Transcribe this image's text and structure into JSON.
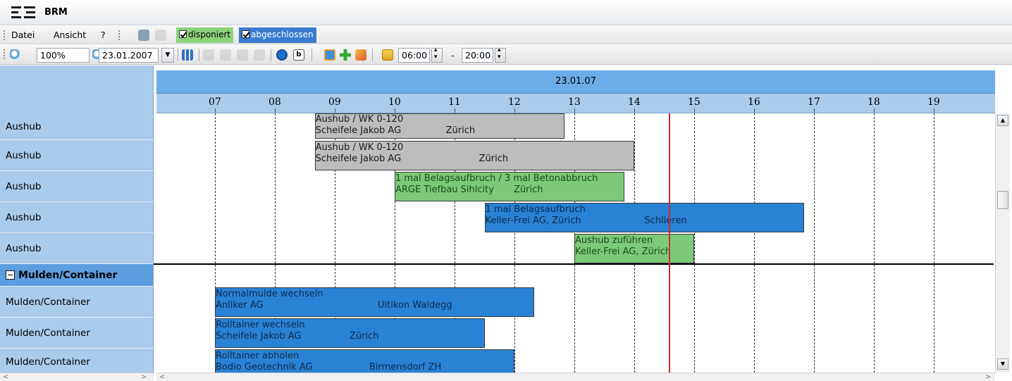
{
  "app": {
    "title": "BRM"
  },
  "menu": {
    "items": [
      "Datei",
      "Ansicht",
      "?"
    ],
    "checkboxes": [
      {
        "label": "disponiert",
        "checked": true,
        "color": "#8cd27a"
      },
      {
        "label": "abgeschlossen",
        "checked": true,
        "color": "#3a7bd0"
      }
    ]
  },
  "toolbar": {
    "zoom": "100%",
    "date": "23.01.2007",
    "time_from": "06:00",
    "separator": "-",
    "time_to": "20:00",
    "icons": [
      "zoom-in-icon",
      "zoom-out-icon",
      "filter-icon",
      "page-icon",
      "globe-icon",
      "bold-icon",
      "blue-square-icon",
      "add-icon",
      "arrow-icon",
      "sort-icon"
    ]
  },
  "gantt": {
    "date_header": "23.01.07",
    "hours": [
      "07",
      "08",
      "09",
      "10",
      "11",
      "12",
      "13",
      "14",
      "15",
      "16",
      "17",
      "18",
      "19"
    ],
    "current_time": "14:35",
    "colors": {
      "gray": "#bdbdbd",
      "green": "#7dc97a",
      "blue": "#2a82d4",
      "now_line": "#d42a2a"
    },
    "rows": [
      {
        "label": "Aushub",
        "group": false
      },
      {
        "label": "Aushub",
        "group": false
      },
      {
        "label": "Aushub",
        "group": false
      },
      {
        "label": "Aushub",
        "group": false
      },
      {
        "label": "Aushub",
        "group": false
      },
      {
        "label": "Mulden/Container",
        "group": true
      },
      {
        "label": "Mulden/Container",
        "group": false
      },
      {
        "label": "Mulden/Container",
        "group": false
      },
      {
        "label": "Mulden/Container",
        "group": false
      }
    ],
    "tasks": [
      {
        "row": 0,
        "start": "08:40",
        "end": "12:50",
        "status": "gray",
        "line1": "Aushub / WK 0-120",
        "line2a": "Scheifele Jakob AG",
        "line2b": "Zürich"
      },
      {
        "row": 1,
        "start": "08:40",
        "end": "14:00",
        "status": "gray",
        "line1": "Aushub / WK 0-120",
        "line2a": "Scheifele Jakob AG",
        "line2b": "Zürich"
      },
      {
        "row": 2,
        "start": "10:00",
        "end": "13:50",
        "status": "green",
        "line1": "1 mal Belagsaufbruch / 3 mal Betonabbruch",
        "line2a": "ARGE Tiefbau Sihlcity",
        "line2b": "Zürich"
      },
      {
        "row": 3,
        "start": "11:30",
        "end": "16:50",
        "status": "blue",
        "line1": "1 mal Belagsaufbruch",
        "line2a": "Keller-Frei AG, Zürich",
        "line2b": "Schlieren"
      },
      {
        "row": 4,
        "start": "13:00",
        "end": "15:00",
        "status": "green",
        "line1": "Aushub zuführen",
        "line2a": "Keller-Frei AG, Zürich",
        "line2b": ""
      },
      {
        "row": 6,
        "start": "07:00",
        "end": "12:20",
        "status": "blue",
        "line1": "Normalmulde wechseln",
        "line2a": "Anliker AG",
        "line2b": "Uitikon Waldegg"
      },
      {
        "row": 7,
        "start": "07:00",
        "end": "11:30",
        "status": "blue",
        "line1": "Rolltainer wechseln",
        "line2a": "Scheifele Jakob AG",
        "line2b": "Zürich"
      },
      {
        "row": 8,
        "start": "07:00",
        "end": "12:00",
        "status": "blue",
        "line1": "Rolltainer abholen",
        "line2a": "Bodio Geotechnik AG",
        "line2b": "Birmensdorf ZH"
      }
    ]
  }
}
